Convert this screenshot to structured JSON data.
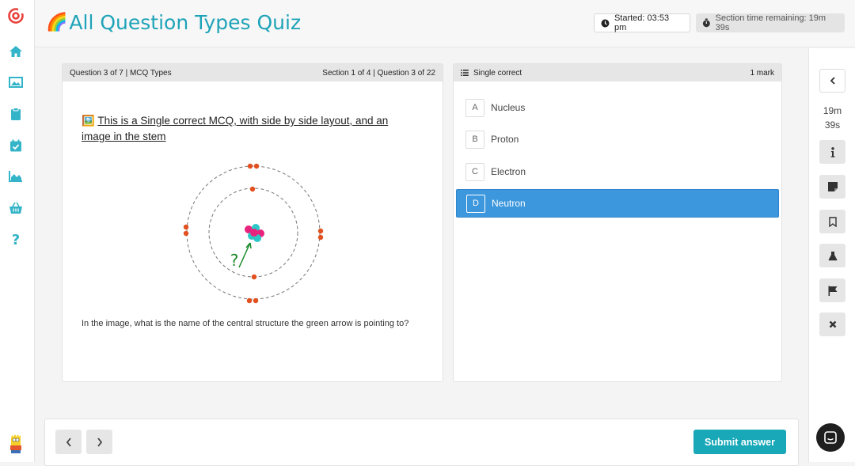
{
  "header": {
    "title_emoji": "🌈",
    "title": "All Question Types Quiz",
    "started": "Started: 03:53 pm",
    "section_time": "Section time remaining: 19m 39s"
  },
  "sidebar": {
    "items": [
      {
        "icon": "home-icon"
      },
      {
        "icon": "gallery-icon"
      },
      {
        "icon": "clipboard-icon"
      },
      {
        "icon": "calendar-check-icon"
      },
      {
        "icon": "area-chart-icon"
      },
      {
        "icon": "basket-icon"
      },
      {
        "icon": "help-icon"
      }
    ]
  },
  "question_panel": {
    "left_header": "Question 3 of 7 | MCQ Types",
    "right_header": "Section 1 of 4 | Question 3 of 22",
    "title_emoji": "🖼️",
    "title": "This is a Single correct MCQ, with side by side layout, and an image in the stem",
    "figure_label": "?",
    "body": "In the image, what is the name of the central structure the green arrow is pointing to?"
  },
  "answer_panel": {
    "type_label": "Single correct",
    "marks": "1 mark",
    "options": [
      {
        "letter": "A",
        "label": "Nucleus"
      },
      {
        "letter": "B",
        "label": "Proton"
      },
      {
        "letter": "C",
        "label": "Electron"
      },
      {
        "letter": "D",
        "label": "Neutron"
      }
    ],
    "selected": "D"
  },
  "right_rail": {
    "time_minutes": "19m",
    "time_seconds": "39s",
    "buttons": [
      "collapse-icon",
      "info-icon",
      "note-icon",
      "bookmark-icon",
      "flask-icon",
      "flag-icon",
      "close-icon"
    ]
  },
  "footer": {
    "submit_label": "Submit answer"
  },
  "colors": {
    "accent": "#1fa3b8",
    "selected": "#3c97dd",
    "submit": "#18a8b8"
  }
}
